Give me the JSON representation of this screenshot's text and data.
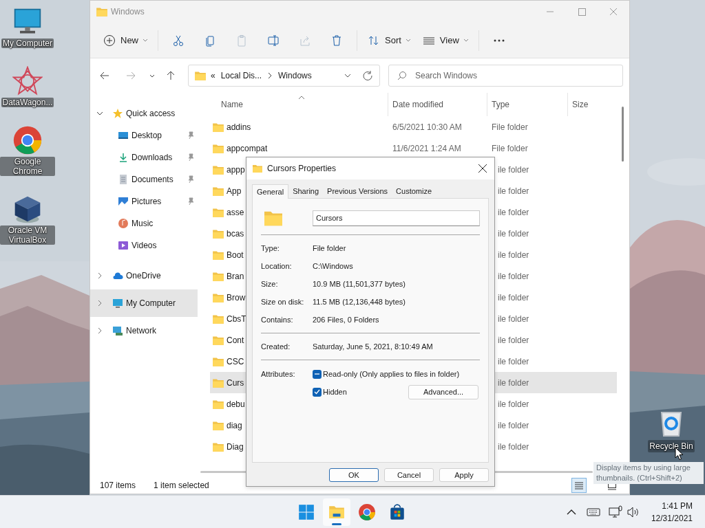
{
  "desktop_icons": [
    {
      "kind": "computer",
      "label": "My Computer"
    },
    {
      "kind": "star",
      "label": "DataWagon..."
    },
    {
      "kind": "chrome",
      "label": "Google Chrome"
    },
    {
      "kind": "cube",
      "label": "Oracle VM VirtualBox"
    }
  ],
  "recycle_bin": {
    "label": "Recycle Bin"
  },
  "explorer": {
    "title": "Windows",
    "toolbar": [
      {
        "kind": "new",
        "label": "New",
        "disabled": false
      },
      {
        "kind": "cut",
        "disabled": false
      },
      {
        "kind": "copy",
        "disabled": false
      },
      {
        "kind": "paste",
        "disabled": true
      },
      {
        "kind": "rename",
        "disabled": false
      },
      {
        "kind": "share",
        "disabled": true
      },
      {
        "kind": "delete",
        "disabled": false
      },
      {
        "kind": "sort",
        "label": "Sort",
        "disabled": false
      },
      {
        "kind": "view",
        "label": "View",
        "disabled": false
      },
      {
        "kind": "more",
        "disabled": false
      }
    ],
    "address": {
      "overflow": "«",
      "path": [
        "Local Dis...",
        "Windows"
      ]
    },
    "search": {
      "placeholder": "Search Windows"
    },
    "sidebar": [
      {
        "kind": "star",
        "label": "Quick access",
        "expanded": true,
        "selected": false,
        "children": [
          {
            "kind": "desktop",
            "label": "Desktop",
            "pinned": true,
            "selected": false
          },
          {
            "kind": "download",
            "label": "Downloads",
            "pinned": true,
            "selected": false
          },
          {
            "kind": "document",
            "label": "Documents",
            "pinned": true,
            "selected": false
          },
          {
            "kind": "picture",
            "label": "Pictures",
            "pinned": true,
            "selected": false
          },
          {
            "kind": "music",
            "label": "Music",
            "pinned": false,
            "selected": false
          },
          {
            "kind": "video",
            "label": "Videos",
            "pinned": false,
            "selected": false
          }
        ]
      },
      {
        "kind": "cloud",
        "label": "OneDrive",
        "expanded": false,
        "selected": false
      },
      {
        "kind": "computer",
        "label": "My Computer",
        "expanded": false,
        "selected": true
      },
      {
        "kind": "network",
        "label": "Network",
        "expanded": false,
        "selected": false
      }
    ],
    "columns": [
      "Name",
      "Date modified",
      "Type",
      "Size"
    ],
    "rows": [
      {
        "name": "addins",
        "date": "6/5/2021 10:30 AM",
        "type": "File folder",
        "selected": false
      },
      {
        "name": "appcompat",
        "date": "11/6/2021 1:24 AM",
        "type": "File folder",
        "selected": false
      },
      {
        "name": "appp",
        "type": "ile folder",
        "selected": false
      },
      {
        "name": "App",
        "type": "ile folder",
        "selected": false
      },
      {
        "name": "asse",
        "type": "ile folder",
        "selected": false
      },
      {
        "name": "bcas",
        "type": "ile folder",
        "selected": false
      },
      {
        "name": "Boot",
        "type": "ile folder",
        "selected": false
      },
      {
        "name": "Bran",
        "type": "ile folder",
        "selected": false
      },
      {
        "name": "Brow",
        "type": "ile folder",
        "selected": false
      },
      {
        "name": "CbsT",
        "type": "ile folder",
        "selected": false
      },
      {
        "name": "Cont",
        "type": "ile folder",
        "selected": false
      },
      {
        "name": "CSC",
        "type": "ile folder",
        "selected": false
      },
      {
        "name": "Curs",
        "type": "ile folder",
        "selected": true
      },
      {
        "name": "debu",
        "type": "ile folder",
        "selected": false
      },
      {
        "name": "diag",
        "type": "ile folder",
        "selected": false
      },
      {
        "name": "Diag",
        "type": "ile folder",
        "selected": false
      }
    ],
    "status": {
      "items": "107 items",
      "selection": "1 item selected"
    },
    "view_buttons": [
      {
        "kind": "details",
        "selected": true
      },
      {
        "kind": "tiles",
        "selected": false
      }
    ]
  },
  "dialog": {
    "title": "Cursors Properties",
    "tabs": [
      {
        "label": "General",
        "selected": true
      },
      {
        "label": "Sharing",
        "selected": false
      },
      {
        "label": "Previous Versions",
        "selected": false
      },
      {
        "label": "Customize",
        "selected": false
      }
    ],
    "name_field": "Cursors",
    "groups": [
      [
        {
          "label": "Type:",
          "value": "File folder"
        },
        {
          "label": "Location:",
          "value": "C:\\Windows"
        },
        {
          "label": "Size:",
          "value": "10.9 MB (11,501,377 bytes)"
        },
        {
          "label": "Size on disk:",
          "value": "11.5 MB (12,136,448 bytes)"
        },
        {
          "label": "Contains:",
          "value": "206 Files, 0 Folders"
        }
      ],
      [
        {
          "label": "Created:",
          "value": "Saturday, June 5, 2021, 8:10:49 AM"
        }
      ]
    ],
    "attributes_label": "Attributes:",
    "attributes": [
      {
        "label": "Read-only (Only applies to files in folder)",
        "checked": true,
        "indeterminate": true
      },
      {
        "label": "Hidden",
        "checked": true,
        "indeterminate": false
      }
    ],
    "advanced_button": "Advanced...",
    "buttons": [
      {
        "label": "OK",
        "default": true
      },
      {
        "label": "Cancel",
        "default": false
      },
      {
        "label": "Apply",
        "default": false
      }
    ]
  },
  "tooltip": "Display items by using large thumbnails. (Ctrl+Shift+2)",
  "taskbar": {
    "apps": [
      {
        "kind": "start",
        "active": false
      },
      {
        "kind": "explorer",
        "active": true
      },
      {
        "kind": "chrome",
        "active": false
      },
      {
        "kind": "store",
        "active": false
      }
    ],
    "time": "1:41 PM",
    "date": "12/31/2021"
  }
}
